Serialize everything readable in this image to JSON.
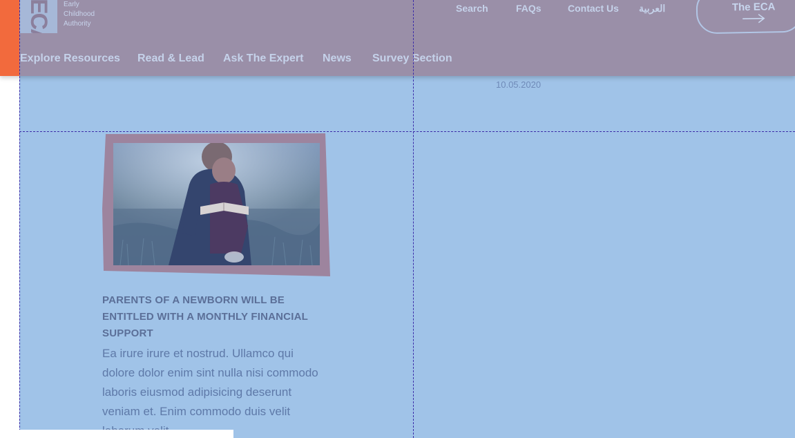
{
  "logo": {
    "line1": "Early",
    "line2": "Childhood",
    "line3": "Authority"
  },
  "utility_nav": {
    "search": "Search",
    "faqs": "FAQs",
    "contact": "Contact Us",
    "arabic": "العربية"
  },
  "eca_button": {
    "label": "The ECA",
    "icon": "arrow-right-icon"
  },
  "main_nav": {
    "items": [
      {
        "label": "Explore Resources"
      },
      {
        "label": "Read & Lead"
      },
      {
        "label": "Ask The Expert"
      },
      {
        "label": "News"
      },
      {
        "label": "Survey Section"
      }
    ]
  },
  "previous_item": {
    "date": "10.05.2020"
  },
  "article": {
    "title": "PARENTS OF A NEWBORN WILL BE ENTITLED WITH A MONTHLY FINANCIAL SUPPORT",
    "body": "Ea irure irure et nostrud. Ullamco qui dolore dolor enim sint nulla nisi commodo laboris eiusmod adipisicing deserunt veniam et. Enim commodo duis velit laborum velit"
  },
  "colors": {
    "header_overlay": "#9a8fa8",
    "page_overlay": "#a0c3e8",
    "accent_orange": "#f26a3d",
    "guide_line": "#3a2aa8"
  }
}
